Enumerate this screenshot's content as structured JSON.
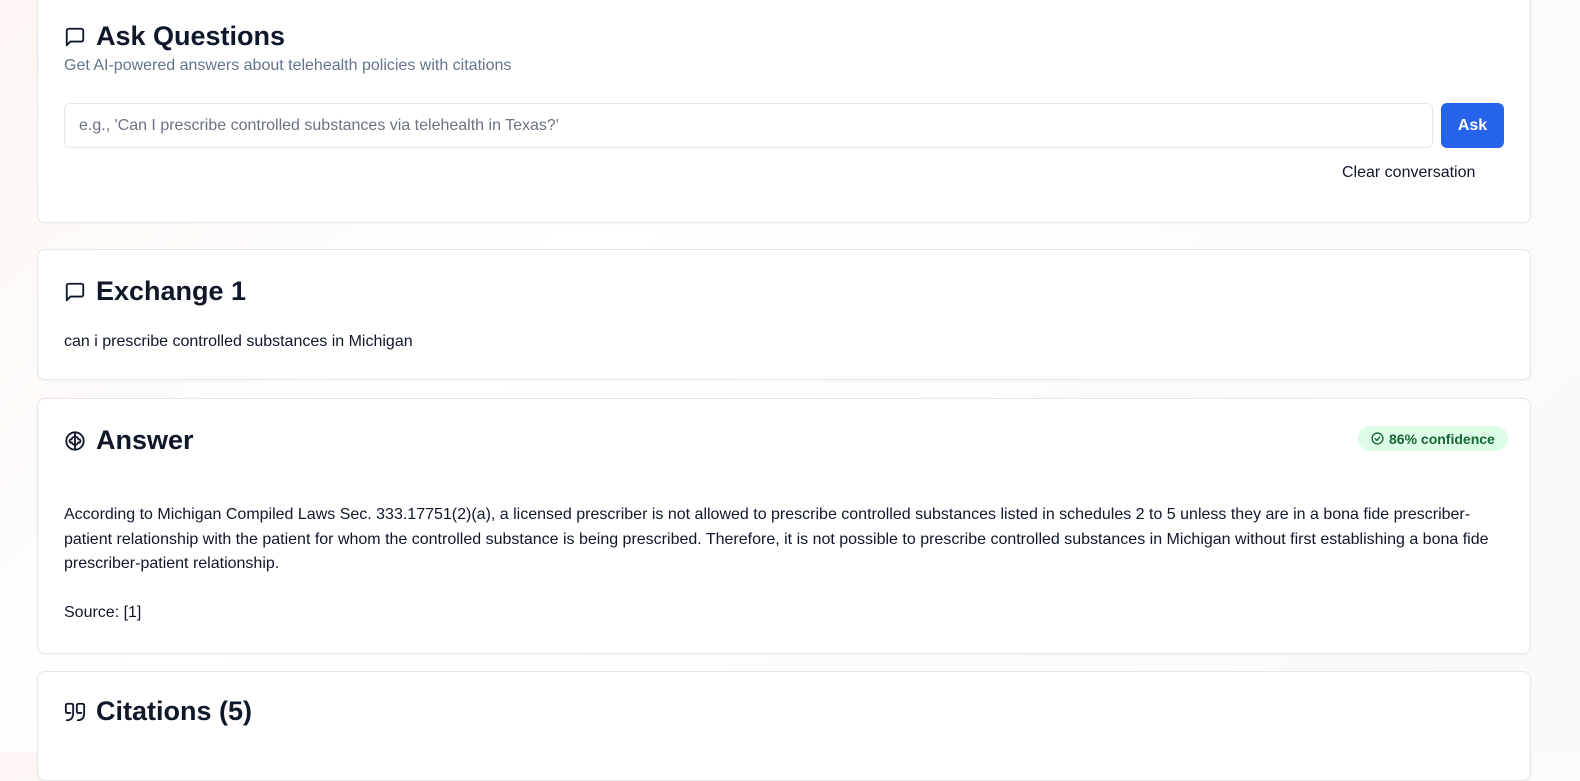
{
  "ask": {
    "title": "Ask Questions",
    "subtitle": "Get AI-powered answers about telehealth policies with citations",
    "input_value": "",
    "input_placeholder": "e.g., 'Can I prescribe controlled substances via telehealth in Texas?'",
    "ask_label": "Ask",
    "clear_label": "Clear conversation"
  },
  "exchange": {
    "title": "Exchange 1",
    "question": "can i prescribe controlled substances in Michigan"
  },
  "answer": {
    "title": "Answer",
    "confidence": "86% confidence",
    "text": "According to Michigan Compiled Laws Sec. 333.17751(2)(a), a licensed prescriber is not allowed to prescribe controlled substances listed in schedules 2 to 5 unless they are in a bona fide prescriber-patient relationship with the patient for whom the controlled substance is being prescribed. Therefore, it is not possible to prescribe controlled substances in Michigan without first establishing a bona fide prescriber-patient relationship.",
    "source": "Source: [1]"
  },
  "citations": {
    "title": "Citations (5)"
  },
  "colors": {
    "primary": "#2563eb",
    "badge_bg": "#dcfce7",
    "badge_text": "#166534",
    "muted_text": "#64748b"
  },
  "icons": {
    "ask": "message-square-icon",
    "exchange": "message-square-icon",
    "answer": "brain-icon",
    "confidence": "check-circle-icon",
    "citations": "quote-icon"
  }
}
